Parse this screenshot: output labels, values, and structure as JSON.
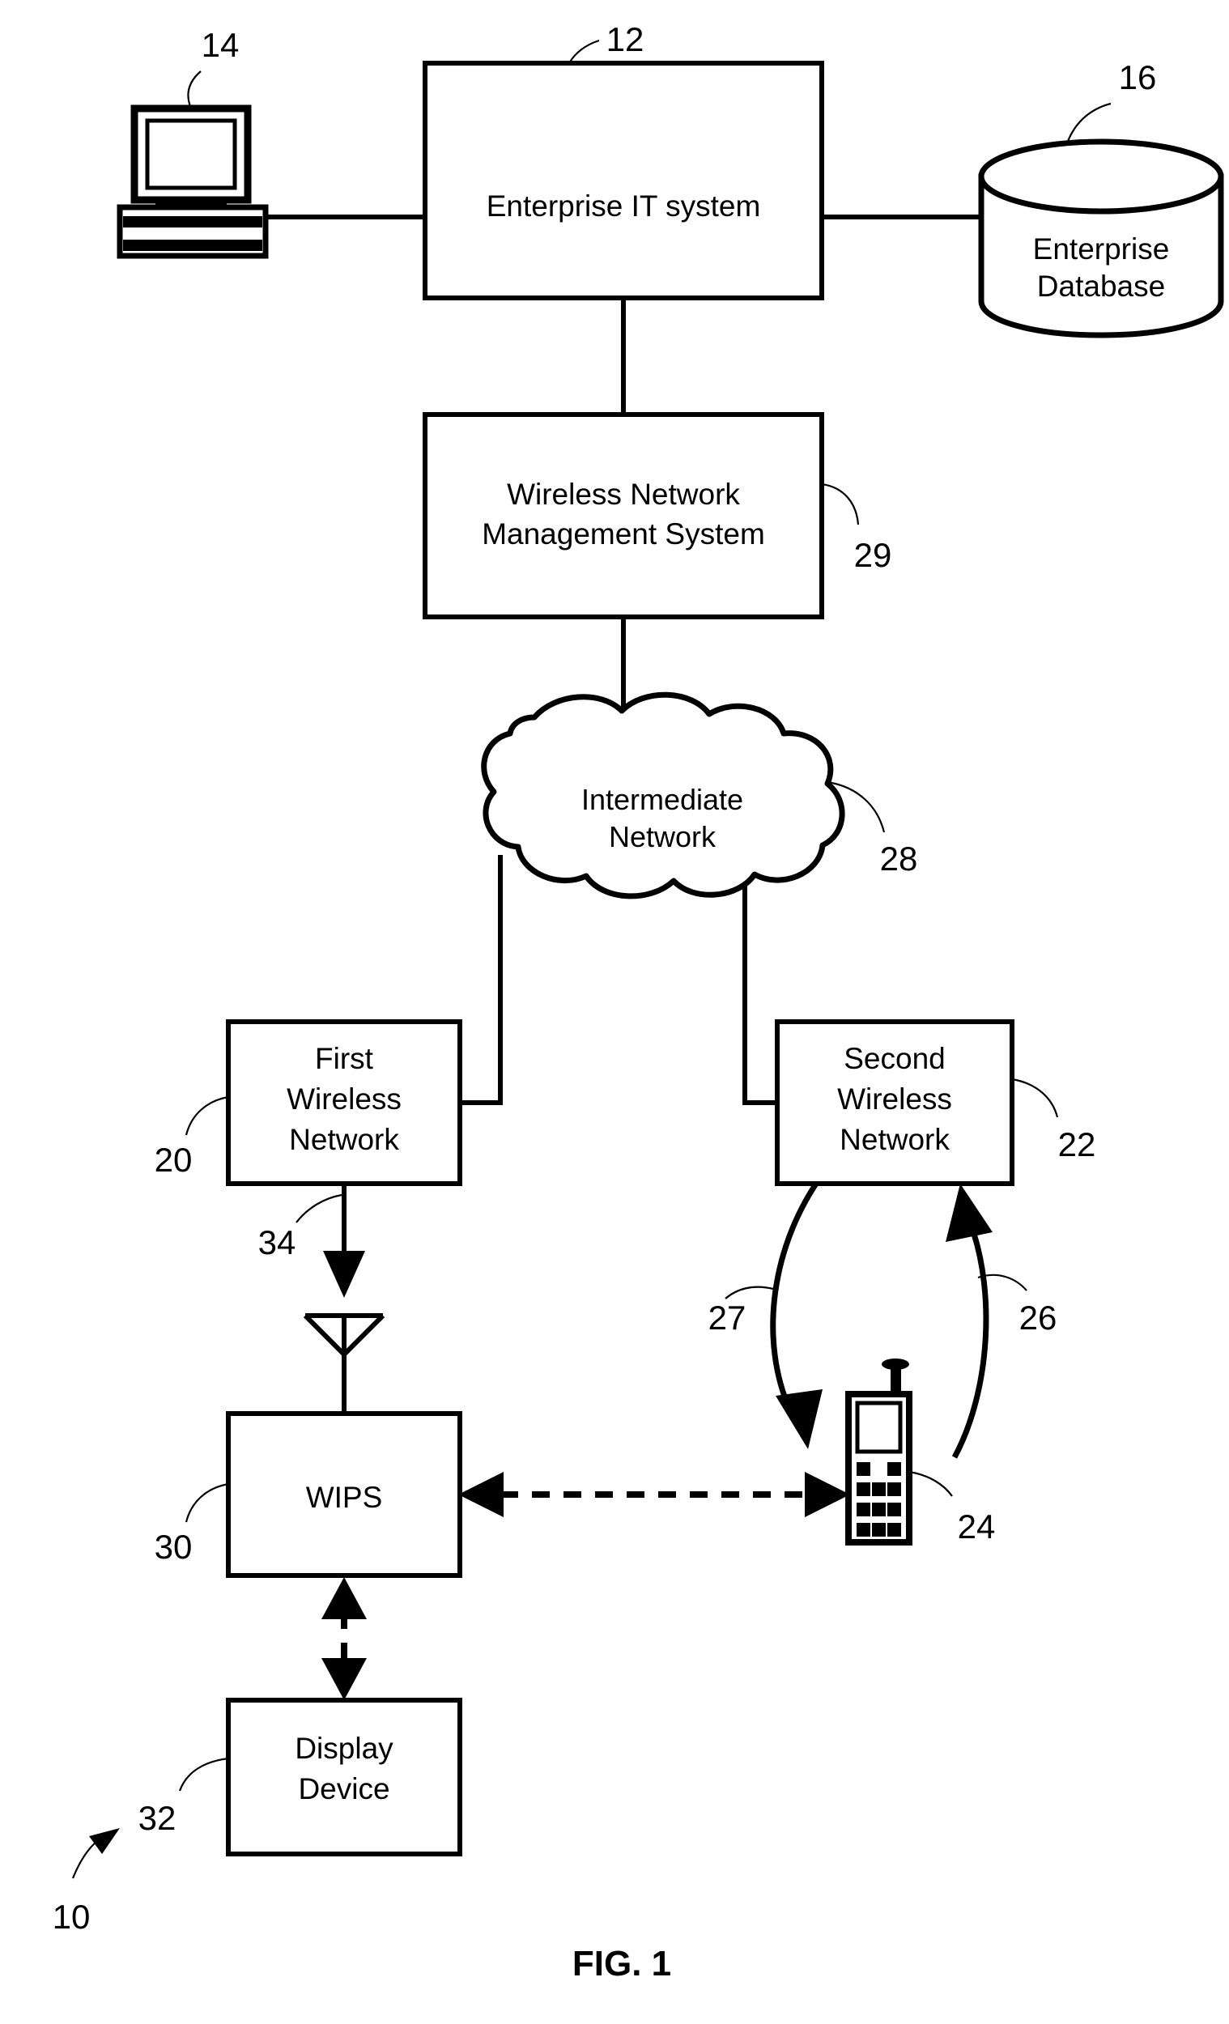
{
  "figure": {
    "caption": "FIG. 1",
    "overall_ref": "10"
  },
  "nodes": {
    "workstation": {
      "ref": "14",
      "icon": "desktop-computer-icon"
    },
    "enterprise_it": {
      "label": "Enterprise IT system",
      "ref": "12"
    },
    "enterprise_db": {
      "label_line1": "Enterprise",
      "label_line2": "Database",
      "ref": "16",
      "icon": "database-cylinder-icon"
    },
    "wnms": {
      "label_line1": "Wireless Network",
      "label_line2": "Management System",
      "ref": "29"
    },
    "intermediate_network": {
      "label_line1": "Intermediate",
      "label_line2": "Network",
      "ref": "28",
      "icon": "cloud-icon"
    },
    "first_wireless_network": {
      "label_line1": "First",
      "label_line2": "Wireless",
      "label_line3": "Network",
      "ref": "20"
    },
    "second_wireless_network": {
      "label_line1": "Second",
      "label_line2": "Wireless",
      "label_line3": "Network",
      "ref": "22"
    },
    "wips": {
      "label": "WIPS",
      "ref": "30",
      "icon": "antenna-icon"
    },
    "display_device": {
      "label_line1": "Display",
      "label_line2": "Device",
      "ref": "32"
    },
    "mobile_station": {
      "ref": "24",
      "icon": "mobile-phone-icon"
    }
  },
  "links": {
    "first_network_to_antenna": {
      "ref": "34"
    },
    "second_network_to_phone_downlink": {
      "ref": "27"
    },
    "phone_to_second_network_uplink": {
      "ref": "26"
    }
  },
  "colors": {
    "line": "#000000",
    "background": "#ffffff",
    "fill": "#ffffff"
  }
}
